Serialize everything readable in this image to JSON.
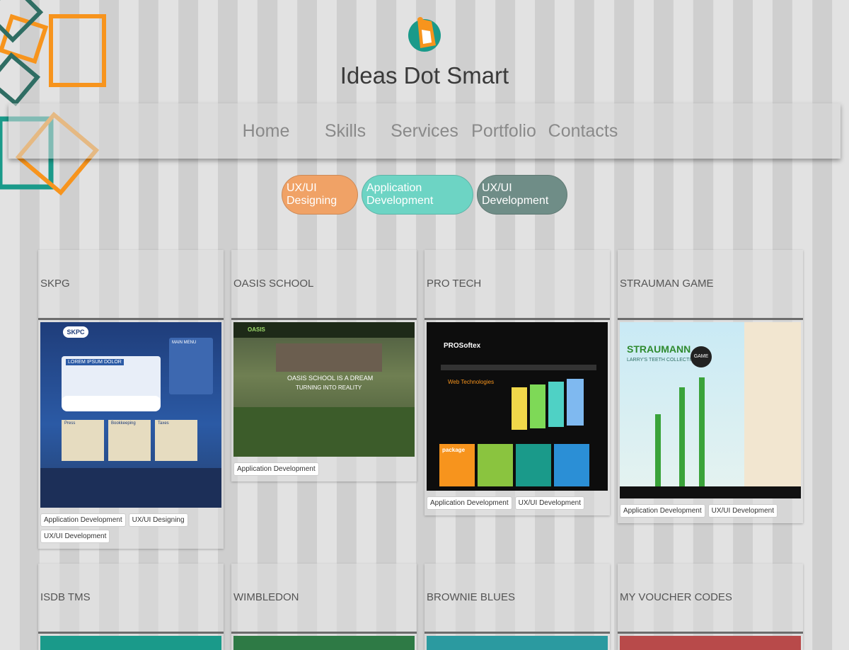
{
  "brand": {
    "name": "Ideas Dot Smart"
  },
  "nav": {
    "items": [
      "Home",
      "Skills",
      "Services",
      "Portfolio",
      "Contacts"
    ]
  },
  "filters": [
    "UX/UI Designing",
    "Application Development",
    "UX/UI Development"
  ],
  "cards": [
    {
      "title": "SKPG",
      "tags": [
        "Application Development",
        "UX/UI Designing",
        "UX/UI Development"
      ]
    },
    {
      "title": "OASIS SCHOOL",
      "tags": [
        "Application Development"
      ]
    },
    {
      "title": "PRO TECH",
      "tags": [
        "Application Development",
        "UX/UI Development"
      ]
    },
    {
      "title": "STRAUMAN GAME",
      "tags": [
        "Application Development",
        "UX/UI Development"
      ]
    },
    {
      "title": "ISDB TMS",
      "tags": []
    },
    {
      "title": "WIMBLEDON",
      "tags": []
    },
    {
      "title": "BROWNIE BLUES",
      "tags": []
    },
    {
      "title": "MY VOUCHER CODES",
      "tags": []
    }
  ],
  "thumbs": {
    "skpg": {
      "logo": "SKPC",
      "heading": "LOREM IPSUM DOLOR",
      "menu": "MAIN MENU",
      "col1": "Press",
      "col2": "Bookkeeping",
      "col3": "Taxes"
    },
    "oasis": {
      "logo": "OASIS",
      "line1": "OASIS SCHOOL IS A DREAM",
      "line2": "TURNING INTO REALITY"
    },
    "pro": {
      "logo": "PROSoftex",
      "heading": "Web Technologies",
      "pkg": "package"
    },
    "str": {
      "title": "STRAUMANN",
      "sub": "LARRY'S TEETH COLLECTIONS",
      "badge": "GAME"
    }
  },
  "colors": {
    "orange": "#f0a266",
    "teal": "#6dd4c4",
    "slate": "#6f8d87",
    "accent": "#f7941d",
    "dark_teal": "#1a9a8a"
  }
}
